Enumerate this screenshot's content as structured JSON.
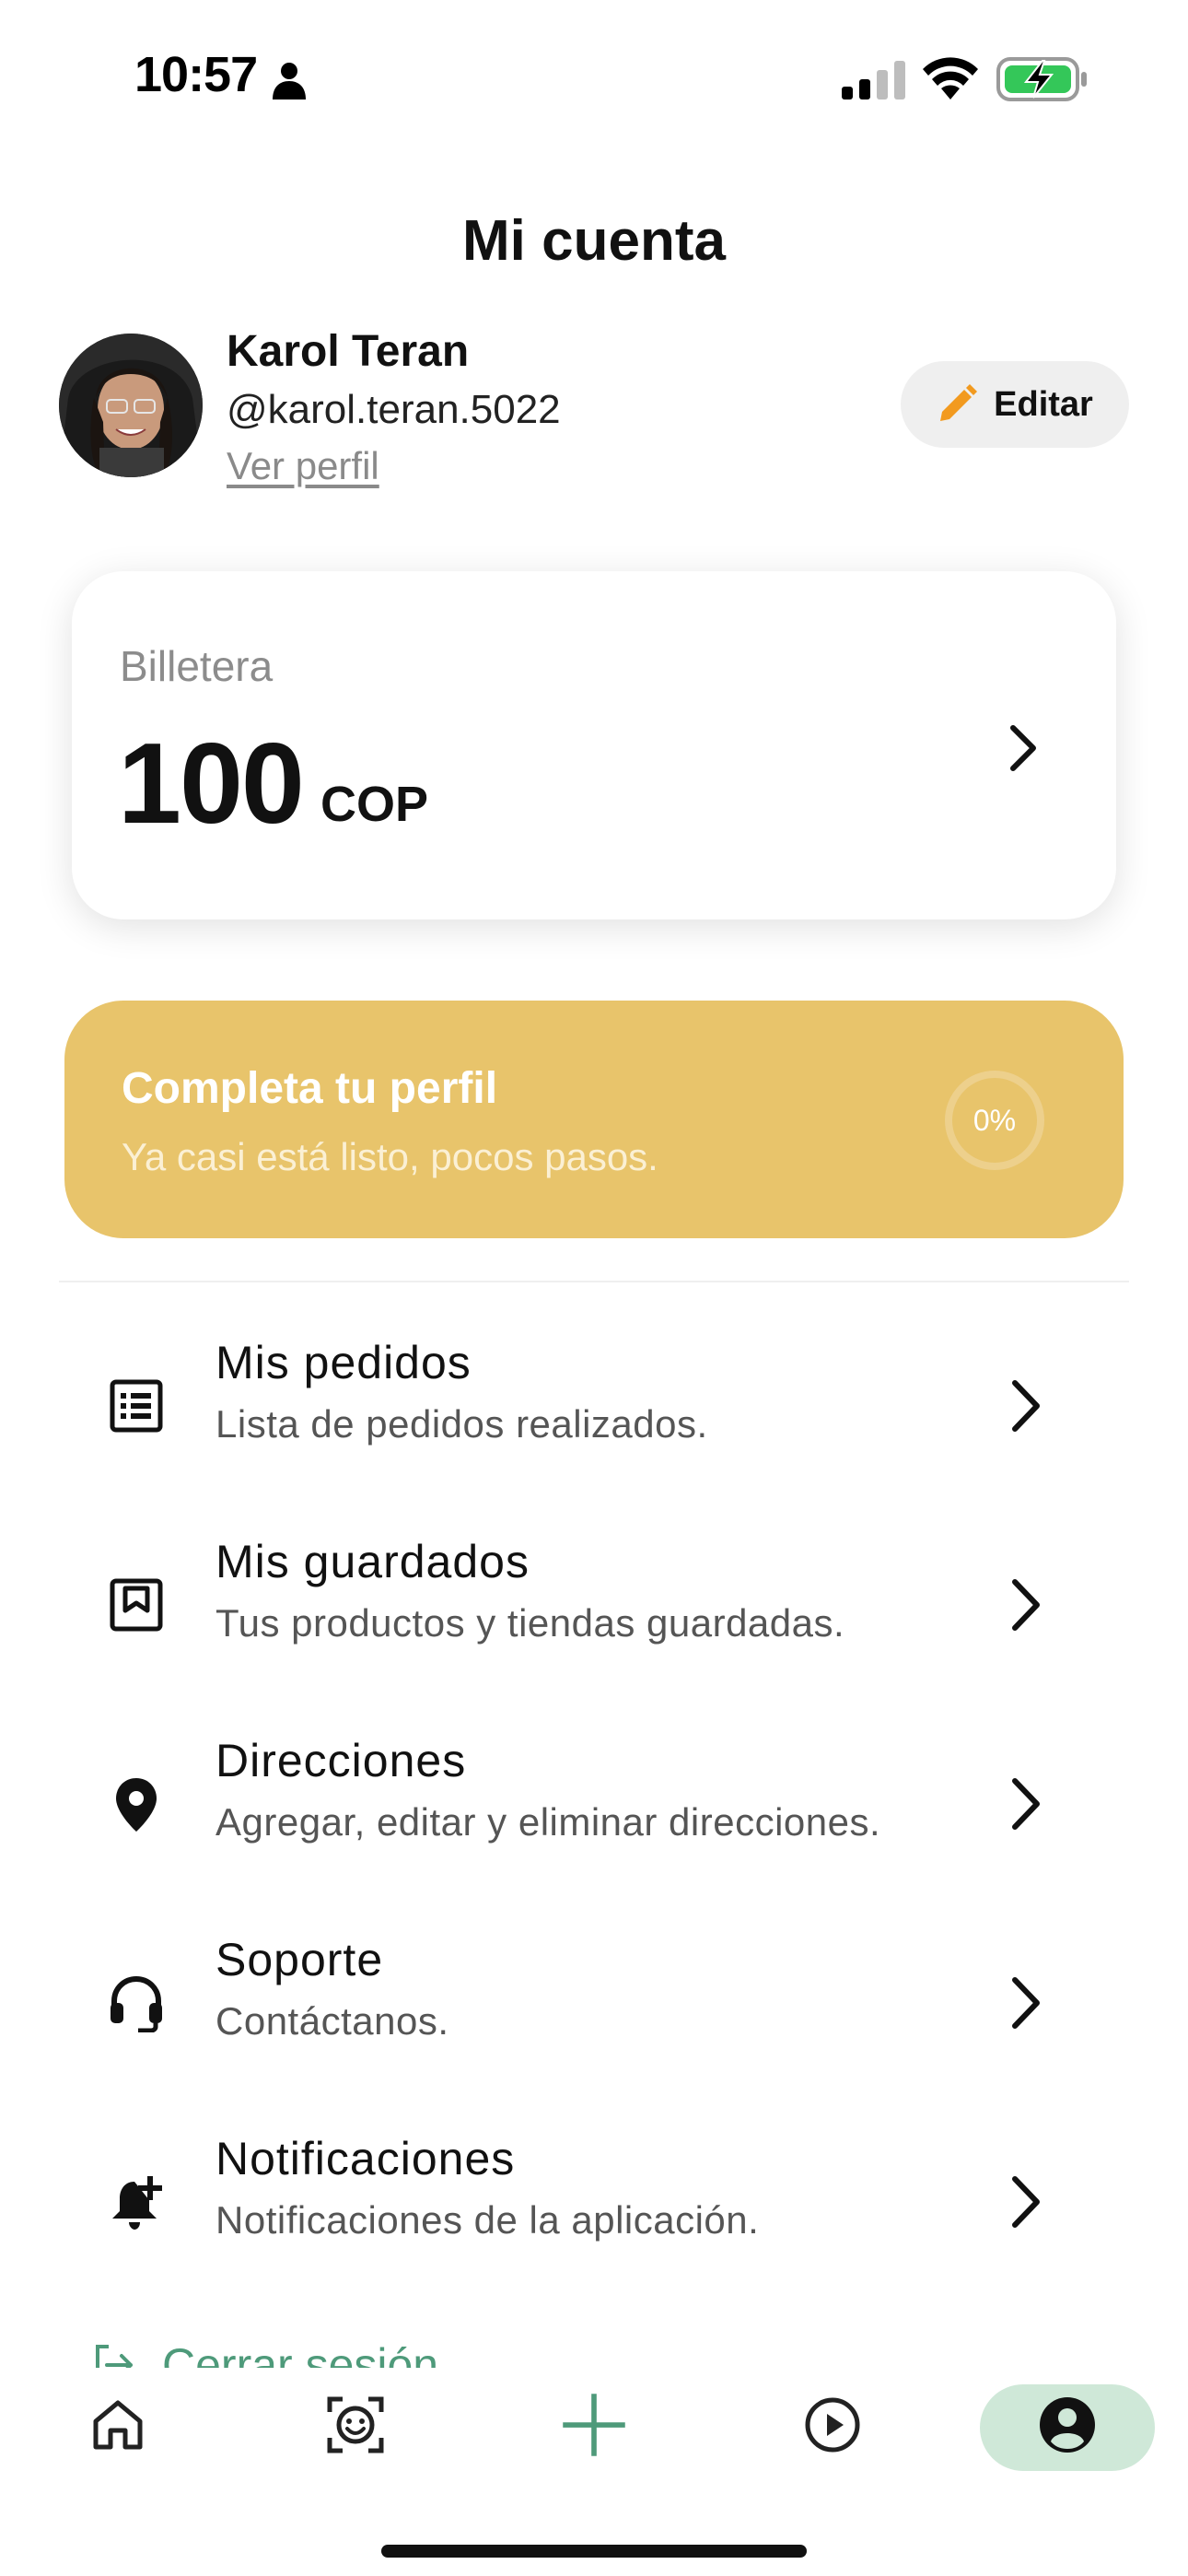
{
  "status_bar": {
    "time": "10:57",
    "icons": [
      "person-icon",
      "signal-icon",
      "wifi-icon",
      "battery-charging-icon"
    ],
    "battery_color": "#34c759"
  },
  "header": {
    "title": "Mi cuenta"
  },
  "profile": {
    "name": "Karol Teran",
    "handle": "@karol.teran.5022",
    "view_profile_label": "Ver perfil",
    "edit_label": "Editar",
    "edit_icon": "pencil-icon",
    "edit_icon_color": "#f29a1f"
  },
  "wallet": {
    "label": "Billetera",
    "amount": "100",
    "currency": "COP"
  },
  "complete_profile": {
    "title": "Completa tu perfil",
    "subtitle": "Ya casi está listo, pocos pasos.",
    "progress_text": "0%",
    "progress": 0,
    "background_color": "#e8c46b"
  },
  "menu": {
    "items": [
      {
        "label": "Mis pedidos",
        "description": "Lista de pedidos realizados.",
        "icon": "list-icon"
      },
      {
        "label": "Mis guardados",
        "description": "Tus productos y tiendas guardadas.",
        "icon": "bookmark-icon"
      },
      {
        "label": "Direcciones",
        "description": "Agregar, editar y eliminar direcciones.",
        "icon": "location-pin-icon"
      },
      {
        "label": "Soporte",
        "description": "Contáctanos.",
        "icon": "headset-icon"
      },
      {
        "label": "Notificaciones",
        "description": "Notificaciones de la aplicación.",
        "icon": "bell-plus-icon"
      }
    ]
  },
  "logout": {
    "label": "Cerrar sesión",
    "icon": "logout-icon",
    "color": "#4e9a7a"
  },
  "tab_bar": {
    "tabs": [
      {
        "name": "home",
        "icon": "home-icon"
      },
      {
        "name": "face",
        "icon": "face-scan-icon"
      },
      {
        "name": "add",
        "icon": "plus-icon"
      },
      {
        "name": "video",
        "icon": "play-circle-icon"
      },
      {
        "name": "account",
        "icon": "account-icon",
        "active": true
      }
    ],
    "active_color": "#cfe8d8",
    "accent_color": "#4e9a7a"
  }
}
